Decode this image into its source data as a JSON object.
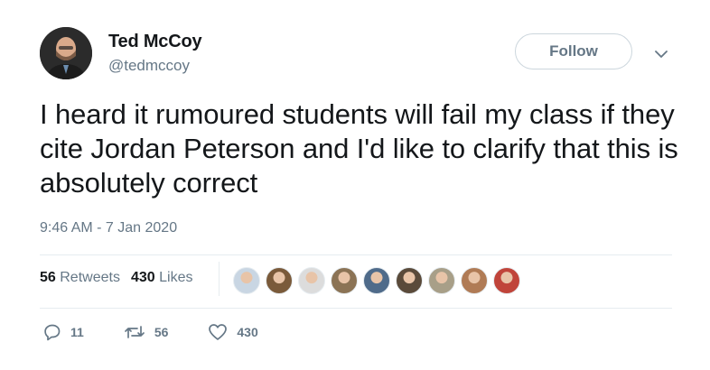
{
  "user": {
    "display_name": "Ted McCoy",
    "handle": "@tedmccoy",
    "avatar_icon": "user-avatar"
  },
  "follow_button": {
    "label": "Follow"
  },
  "tweet": {
    "text": "I heard it rumoured students will fail my class if they cite Jordan Peterson and I'd like to clarify that this is absolutely correct",
    "timestamp": "9:46 AM - 7 Jan 2020"
  },
  "stats": {
    "retweets_count": "56",
    "retweets_label": "Retweets",
    "likes_count": "430",
    "likes_label": "Likes"
  },
  "likers": [
    {
      "icon": "liker-avatar",
      "color": "#c9d6e3"
    },
    {
      "icon": "liker-avatar",
      "color": "#7a5a3a"
    },
    {
      "icon": "liker-avatar",
      "color": "#dcdcdc"
    },
    {
      "icon": "liker-avatar",
      "color": "#8b7355"
    },
    {
      "icon": "liker-avatar",
      "color": "#4f6b8a"
    },
    {
      "icon": "liker-avatar",
      "color": "#5a4a3a"
    },
    {
      "icon": "liker-avatar",
      "color": "#a89f88"
    },
    {
      "icon": "liker-avatar",
      "color": "#b07b55"
    },
    {
      "icon": "liker-avatar",
      "color": "#c0443a"
    }
  ],
  "actions": {
    "reply_count": "11",
    "retweet_count": "56",
    "like_count": "430"
  },
  "colors": {
    "text_primary": "#14171a",
    "text_secondary": "#657786",
    "border": "#ccd6dd",
    "divider": "#e6ecf0"
  }
}
